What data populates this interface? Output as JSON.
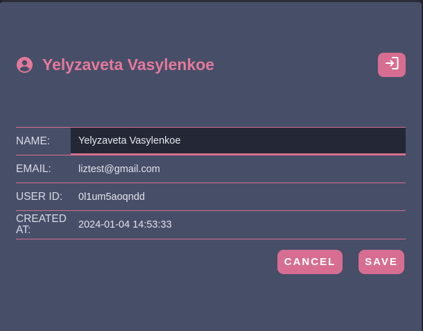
{
  "dialog": {
    "title": "Yelyzaveta Vasylenkoe",
    "user_icon": "account-circle-icon",
    "logout_icon": "logout-icon"
  },
  "fields": [
    {
      "label": "NAME:",
      "value": "Yelyzaveta Vasylenkoe",
      "editable": true
    },
    {
      "label": "EMAIL:",
      "value": "liztest@gmail.com",
      "editable": false
    },
    {
      "label": "USER ID:",
      "value": "0l1um5aoqndd",
      "editable": false
    },
    {
      "label": "CREATED AT:",
      "value": "2024-01-04 14:53:33",
      "editable": false
    }
  ],
  "actions": {
    "cancel_label": "CANCEL",
    "save_label": "SAVE"
  },
  "colors": {
    "panel_bg": "#474e68",
    "accent": "#d76e92",
    "title": "#e3799b",
    "input_bg": "#242836"
  }
}
